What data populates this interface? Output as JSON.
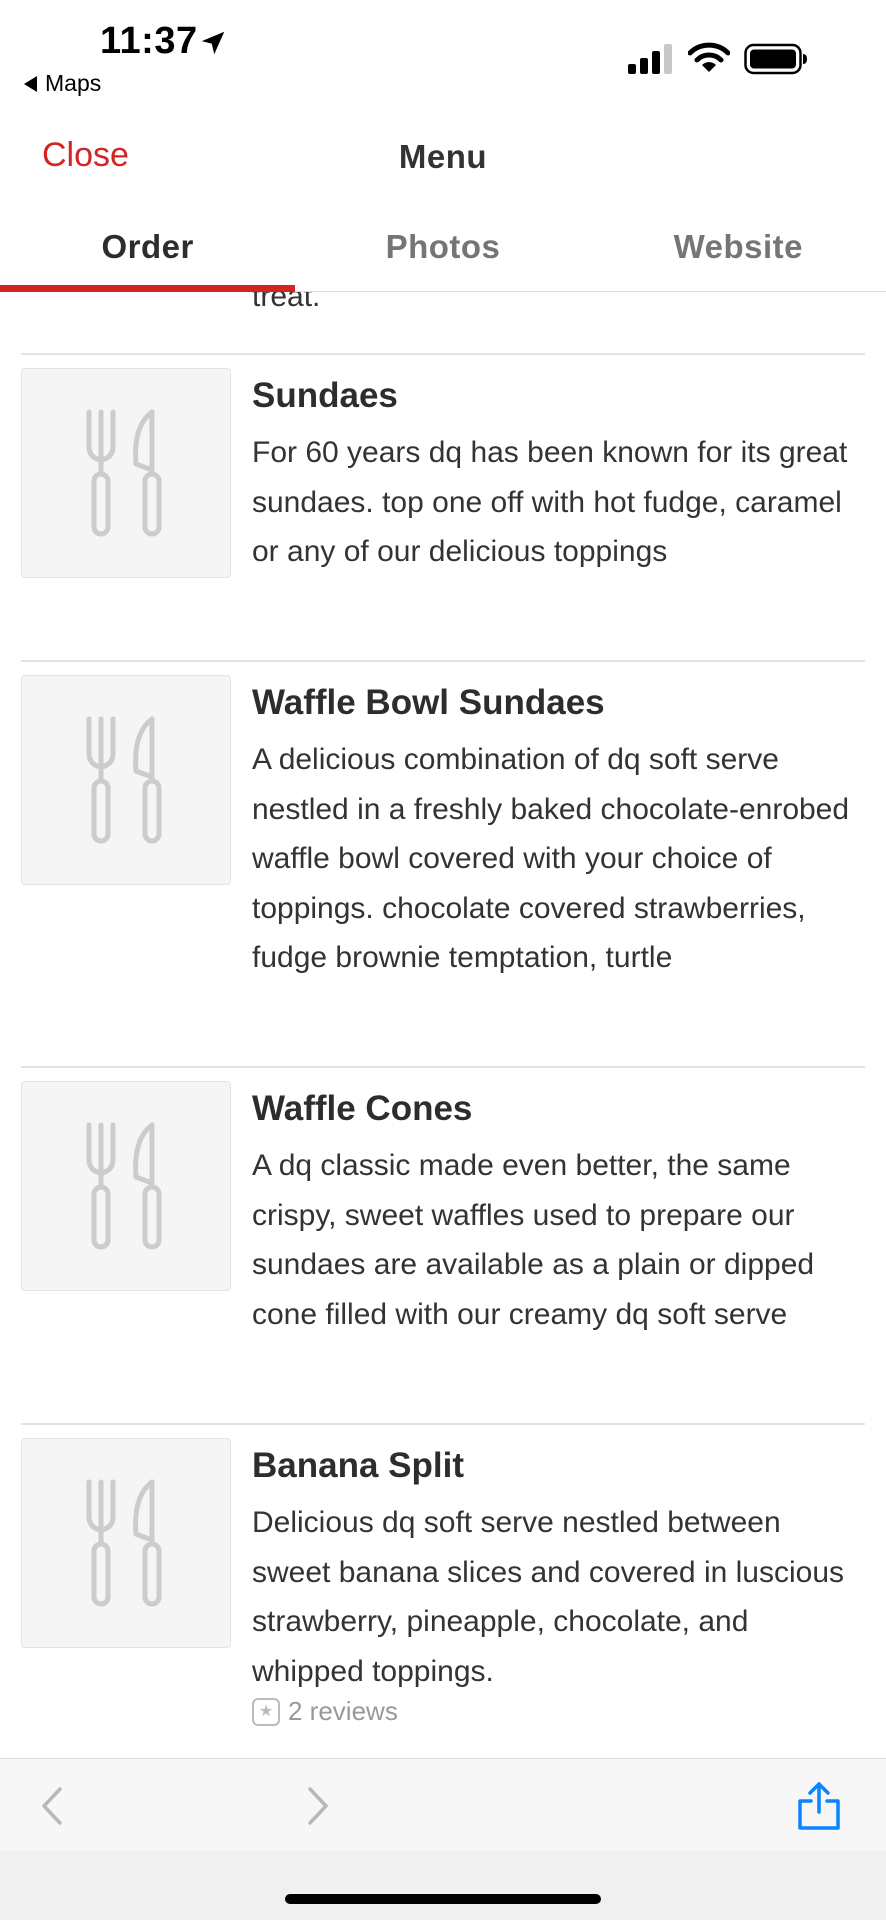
{
  "status_bar": {
    "time": "11:37",
    "back_app": "Maps",
    "icons": [
      "location-arrow-icon",
      "cellular-signal-icon",
      "wifi-icon",
      "battery-icon"
    ]
  },
  "header": {
    "close_label": "Close",
    "title": "Menu"
  },
  "tabs": [
    {
      "label": "Order",
      "active": true
    },
    {
      "label": "Photos",
      "active": false
    },
    {
      "label": "Website",
      "active": false
    }
  ],
  "previous_item_tail": "treat.",
  "items": [
    {
      "title": "Sundaes",
      "description": "For 60 years dq has been known for its great sundaes. top one off with hot fudge, caramel or any of our delicious toppings"
    },
    {
      "title": "Waffle Bowl Sundaes",
      "description": "A delicious combination of dq soft serve nestled in a freshly baked chocolate-enrobed waffle bowl covered with your choice of toppings. chocolate covered strawberries, fudge brownie temptation, turtle"
    },
    {
      "title": "Waffle Cones",
      "description": "A dq classic made even better, the same crispy, sweet waffles used to prepare our sundaes are available as a plain or dipped cone filled with our creamy dq soft serve"
    },
    {
      "title": "Banana Split",
      "description": "Delicious dq soft serve nestled between sweet banana slices and covered in luscious strawberry, pineapple, chocolate, and whipped toppings.",
      "reviews": "2 reviews"
    }
  ],
  "toolbar": {
    "icons": [
      "back-arrow-icon",
      "forward-arrow-icon",
      "share-icon"
    ]
  },
  "colors": {
    "accent_red": "#d32323",
    "link_blue": "#0a84ff",
    "text_dark": "#333333",
    "text_muted": "#757575"
  }
}
